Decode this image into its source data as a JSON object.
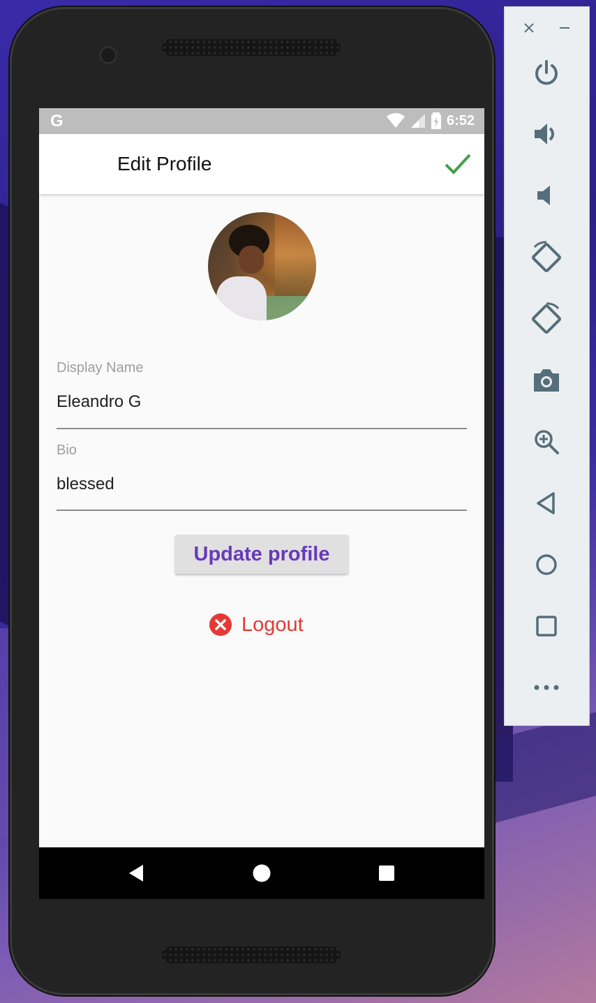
{
  "status_bar": {
    "carrier_icon": "G",
    "time": "6:52"
  },
  "app_bar": {
    "title": "Edit Profile",
    "confirm_icon": "check-icon"
  },
  "profile": {
    "display_name_label": "Display Name",
    "display_name_value": "Eleandro G",
    "bio_label": "Bio",
    "bio_value": "blessed"
  },
  "actions": {
    "update_label": "Update profile",
    "logout_label": "Logout"
  },
  "colors": {
    "accent_purple": "#673ab7",
    "danger_red": "#e53935",
    "check_green": "#43a047"
  },
  "emulator_toolbar": {
    "buttons": [
      "close-icon",
      "minimize-icon",
      "power-icon",
      "volume-up-icon",
      "volume-down-icon",
      "rotate-left-icon",
      "rotate-right-icon",
      "camera-icon",
      "zoom-icon",
      "back-icon",
      "home-icon",
      "overview-icon",
      "more-icon"
    ]
  }
}
